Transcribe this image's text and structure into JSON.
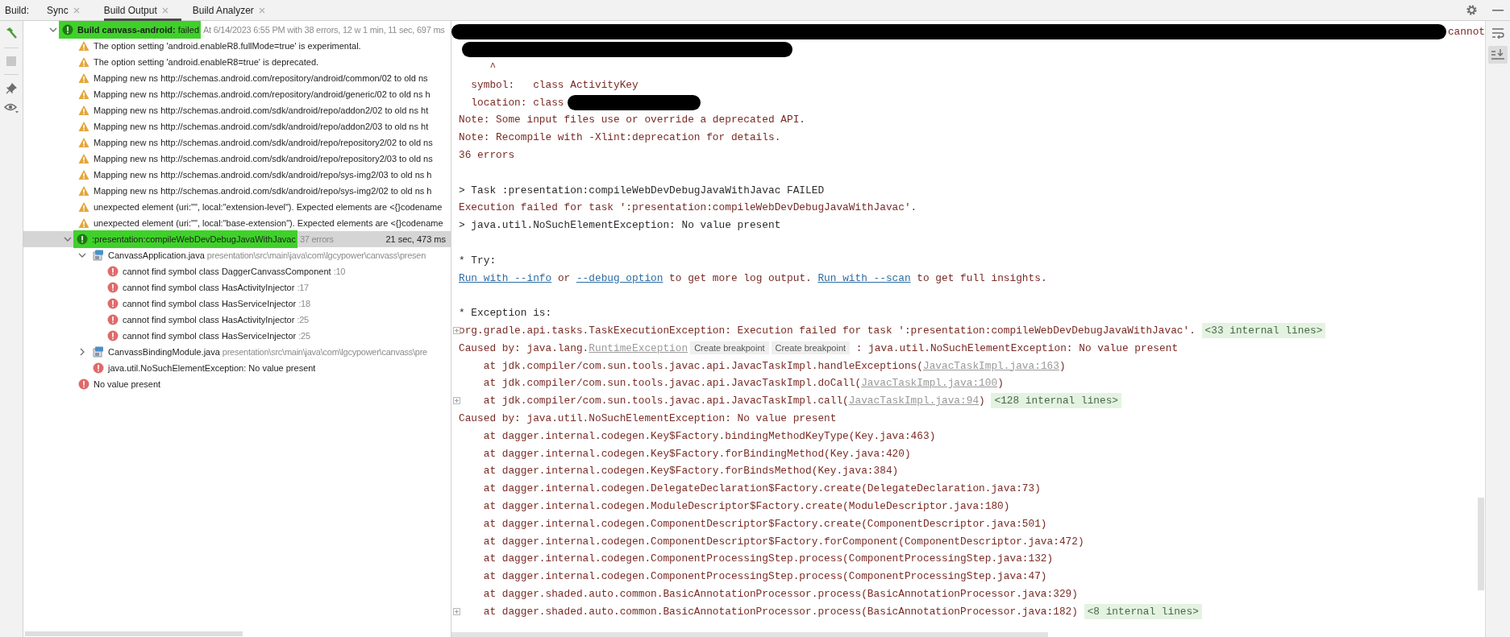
{
  "toolbar": {
    "label": "Build:",
    "tabs": [
      {
        "label": "Sync",
        "selected": false
      },
      {
        "label": "Build Output",
        "selected": true
      },
      {
        "label": "Build Analyzer",
        "selected": false
      }
    ]
  },
  "tree": [
    {
      "kind": "build",
      "title": "**Build canvass-android:** failed",
      "meta": "At 6/14/2023 6:55 PM with 38 errors, 12 w 1 min, 11 sec, 697 ms",
      "expanded": true,
      "selected": false,
      "highlighted": true,
      "children": [
        {
          "kind": "warning",
          "title": "The option setting 'android.enableR8.fullMode=true' is experimental.",
          "selected": false
        },
        {
          "kind": "warning",
          "title": "The option setting 'android.enableR8=true' is deprecated.",
          "selected": false
        },
        {
          "kind": "warning",
          "title": "Mapping new ns http://schemas.android.com/repository/android/common/02 to old ns",
          "selected": false
        },
        {
          "kind": "warning",
          "title": "Mapping new ns http://schemas.android.com/repository/android/generic/02 to old ns h",
          "selected": false
        },
        {
          "kind": "warning",
          "title": "Mapping new ns http://schemas.android.com/sdk/android/repo/addon2/02 to old ns ht",
          "selected": false
        },
        {
          "kind": "warning",
          "title": "Mapping new ns http://schemas.android.com/sdk/android/repo/addon2/03 to old ns ht",
          "selected": false
        },
        {
          "kind": "warning",
          "title": "Mapping new ns http://schemas.android.com/sdk/android/repo/repository2/02 to old ns",
          "selected": false
        },
        {
          "kind": "warning",
          "title": "Mapping new ns http://schemas.android.com/sdk/android/repo/repository2/03 to old ns",
          "selected": false
        },
        {
          "kind": "warning",
          "title": "Mapping new ns http://schemas.android.com/sdk/android/repo/sys-img2/03 to old ns h",
          "selected": false
        },
        {
          "kind": "warning",
          "title": "Mapping new ns http://schemas.android.com/sdk/android/repo/sys-img2/02 to old ns h",
          "selected": false
        },
        {
          "kind": "warning",
          "title": "unexpected element (uri:\"\", local:\"extension-level\"). Expected elements are <{}codename",
          "selected": false
        },
        {
          "kind": "warning",
          "title": "unexpected element (uri:\"\", local:\"base-extension\"). Expected elements are <{}codename",
          "selected": false
        },
        {
          "kind": "task",
          "title": ":presentation:compileWebDevDebugJavaWithJavac",
          "meta": "37 errors",
          "time": "21 sec, 473 ms",
          "expanded": true,
          "selected": true,
          "highlighted": true,
          "children": [
            {
              "kind": "file",
              "title": "CanvassApplication.java",
              "meta": "presentation\\src\\main\\java\\com\\lgcypower\\canvass\\presen",
              "expanded": true,
              "selected": false,
              "children": [
                {
                  "kind": "error",
                  "title": "cannot find symbol class DaggerCanvassComponent",
                  "meta": ":10",
                  "selected": false
                },
                {
                  "kind": "error",
                  "title": "cannot find symbol class HasActivityInjector",
                  "meta": ":17",
                  "selected": false
                },
                {
                  "kind": "error",
                  "title": "cannot find symbol class HasServiceInjector",
                  "meta": ":18",
                  "selected": false
                },
                {
                  "kind": "error",
                  "title": "cannot find symbol class HasActivityInjector",
                  "meta": ":25",
                  "selected": false
                },
                {
                  "kind": "error",
                  "title": "cannot find symbol class HasServiceInjector",
                  "meta": ":25",
                  "selected": false
                }
              ]
            },
            {
              "kind": "file",
              "title": "CanvassBindingModule.java",
              "meta": "presentation\\src\\main\\java\\com\\lgcypower\\canvass\\pre",
              "expanded": false,
              "selected": false
            },
            {
              "kind": "error",
              "title": "java.util.NoSuchElementException: No value present",
              "selected": false
            }
          ]
        },
        {
          "kind": "error",
          "title": "No value present",
          "selected": false
        }
      ]
    }
  ],
  "console": [
    {
      "kind": "stderr",
      "segments": [
        {
          "kind": "redaction_long"
        },
        {
          "kind": "text",
          "text": "cannot"
        }
      ]
    },
    {
      "kind": "stderr",
      "segments": [
        {
          "kind": "redaction_medium"
        }
      ]
    },
    {
      "kind": "stderr",
      "segments": [
        {
          "kind": "text",
          "text": "     ^"
        }
      ]
    },
    {
      "kind": "stderr",
      "segments": [
        {
          "kind": "text",
          "text": "  symbol:   class ActivityKey"
        }
      ]
    },
    {
      "kind": "stderr",
      "segments": [
        {
          "kind": "text",
          "text": "  location: class"
        },
        {
          "kind": "redaction_short"
        }
      ]
    },
    {
      "kind": "stderr",
      "segments": [
        {
          "kind": "text",
          "text": "Note: Some input files use or override a deprecated API."
        }
      ]
    },
    {
      "kind": "stderr",
      "segments": [
        {
          "kind": "text",
          "text": "Note: Recompile with -Xlint:deprecation for details."
        }
      ]
    },
    {
      "kind": "stderr",
      "segments": [
        {
          "kind": "text",
          "text": "36 errors"
        }
      ]
    },
    {
      "kind": "blank"
    },
    {
      "kind": "stdout",
      "segments": [
        {
          "kind": "text",
          "text": "> Task :presentation:compileWebDevDebugJavaWithJavac FAILED"
        }
      ]
    },
    {
      "kind": "stderr",
      "segments": [
        {
          "kind": "text",
          "text": "Execution failed for task ':presentation:compileWebDevDebugJavaWithJavac'."
        }
      ]
    },
    {
      "kind": "stdout",
      "segments": [
        {
          "kind": "text",
          "text": "> java.util.NoSuchElementException: No value present"
        }
      ]
    },
    {
      "kind": "blank"
    },
    {
      "kind": "stdout",
      "segments": [
        {
          "kind": "text",
          "text": "* Try:"
        }
      ]
    },
    {
      "kind": "stderr",
      "segments": [
        {
          "kind": "link",
          "text": "Run with --info"
        },
        {
          "kind": "text",
          "text": " or "
        },
        {
          "kind": "link",
          "text": "--debug option"
        },
        {
          "kind": "text",
          "text": " to get more log output. "
        },
        {
          "kind": "link",
          "text": "Run with --scan"
        },
        {
          "kind": "text",
          "text": " to get full insights."
        }
      ]
    },
    {
      "kind": "blank"
    },
    {
      "kind": "stdout",
      "segments": [
        {
          "kind": "text",
          "text": "* Exception is:"
        }
      ]
    },
    {
      "kind": "stderr",
      "folded": true,
      "segments": [
        {
          "kind": "text",
          "text": "org.gradle.api.tasks.TaskExecutionException: Execution failed for task ':presentation:compileWebDevDebugJavaWithJavac'. "
        },
        {
          "kind": "internal",
          "text": "<33 internal lines>"
        }
      ]
    },
    {
      "kind": "stderr",
      "segments": [
        {
          "kind": "text",
          "text": "Caused by: java.lang."
        },
        {
          "kind": "source",
          "text": "RuntimeException"
        },
        {
          "kind": "chip",
          "text": "Create breakpoint"
        },
        {
          "kind": "chip",
          "text": "Create breakpoint"
        },
        {
          "kind": "text",
          "text": " : java.util.NoSuchElementException: No value present"
        }
      ]
    },
    {
      "kind": "stderr",
      "segments": [
        {
          "kind": "text",
          "text": "    at jdk.compiler/com.sun.tools.javac.api.JavacTaskImpl.handleExceptions("
        },
        {
          "kind": "source",
          "text": "JavacTaskImpl.java:163"
        },
        {
          "kind": "text",
          "text": ")"
        }
      ]
    },
    {
      "kind": "stderr",
      "segments": [
        {
          "kind": "text",
          "text": "    at jdk.compiler/com.sun.tools.javac.api.JavacTaskImpl.doCall("
        },
        {
          "kind": "source",
          "text": "JavacTaskImpl.java:100"
        },
        {
          "kind": "text",
          "text": ")"
        }
      ]
    },
    {
      "kind": "stderr",
      "folded": true,
      "segments": [
        {
          "kind": "text",
          "text": "    at jdk.compiler/com.sun.tools.javac.api.JavacTaskImpl.call("
        },
        {
          "kind": "source",
          "text": "JavacTaskImpl.java:94"
        },
        {
          "kind": "text",
          "text": ") "
        },
        {
          "kind": "internal",
          "text": "<128 internal lines>"
        }
      ]
    },
    {
      "kind": "stderr",
      "segments": [
        {
          "kind": "text",
          "text": "Caused by: java.util.NoSuchElementException: No value present"
        }
      ]
    },
    {
      "kind": "stderr",
      "segments": [
        {
          "kind": "text",
          "text": "    at dagger.internal.codegen.Key$Factory.bindingMethodKeyType(Key.java:463)"
        }
      ]
    },
    {
      "kind": "stderr",
      "segments": [
        {
          "kind": "text",
          "text": "    at dagger.internal.codegen.Key$Factory.forBindingMethod(Key.java:420)"
        }
      ]
    },
    {
      "kind": "stderr",
      "segments": [
        {
          "kind": "text",
          "text": "    at dagger.internal.codegen.Key$Factory.forBindsMethod(Key.java:384)"
        }
      ]
    },
    {
      "kind": "stderr",
      "segments": [
        {
          "kind": "text",
          "text": "    at dagger.internal.codegen.DelegateDeclaration$Factory.create(DelegateDeclaration.java:73)"
        }
      ]
    },
    {
      "kind": "stderr",
      "segments": [
        {
          "kind": "text",
          "text": "    at dagger.internal.codegen.ModuleDescriptor$Factory.create(ModuleDescriptor.java:180)"
        }
      ]
    },
    {
      "kind": "stderr",
      "segments": [
        {
          "kind": "text",
          "text": "    at dagger.internal.codegen.ComponentDescriptor$Factory.create(ComponentDescriptor.java:501)"
        }
      ]
    },
    {
      "kind": "stderr",
      "segments": [
        {
          "kind": "text",
          "text": "    at dagger.internal.codegen.ComponentDescriptor$Factory.forComponent(ComponentDescriptor.java:472)"
        }
      ]
    },
    {
      "kind": "stderr",
      "segments": [
        {
          "kind": "text",
          "text": "    at dagger.internal.codegen.ComponentProcessingStep.process(ComponentProcessingStep.java:132)"
        }
      ]
    },
    {
      "kind": "stderr",
      "segments": [
        {
          "kind": "text",
          "text": "    at dagger.internal.codegen.ComponentProcessingStep.process(ComponentProcessingStep.java:47)"
        }
      ]
    },
    {
      "kind": "stderr",
      "segments": [
        {
          "kind": "text",
          "text": "    at dagger.shaded.auto.common.BasicAnnotationProcessor.process(BasicAnnotationProcessor.java:329)"
        }
      ]
    },
    {
      "kind": "stderr",
      "folded": true,
      "segments": [
        {
          "kind": "text",
          "text": "    at dagger.shaded.auto.common.BasicAnnotationProcessor.process(BasicAnnotationProcessor.java:182) "
        },
        {
          "kind": "internal",
          "text": "<8 internal lines>"
        }
      ]
    }
  ]
}
